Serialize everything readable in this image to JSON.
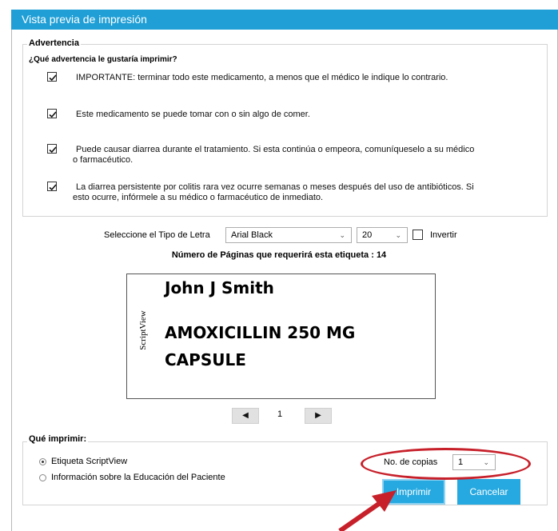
{
  "window": {
    "title": "Vista previa de impresión"
  },
  "warning": {
    "group_title": "Advertencia",
    "question": "¿Qué advertencia le gustaría imprimir?",
    "items": [
      {
        "checked": true,
        "line1": "IMPORTANTE: terminar todo este medicamento, a menos que el médico le indique lo contrario.",
        "line2": ""
      },
      {
        "checked": true,
        "line1": "Este medicamento se puede tomar con o sin algo de comer.",
        "line2": ""
      },
      {
        "checked": true,
        "line1": "Puede causar diarrea durante el tratamiento. Si esta continúa o empeora, comuníqueselo a su médico",
        "line2": "o farmacéutico."
      },
      {
        "checked": true,
        "line1": "La diarrea persistente por colitis rara vez ocurre semanas o meses después del uso de antibióticos. Si",
        "line2": "esto ocurre, infórmele a su médico o farmacéutico de inmediato."
      }
    ]
  },
  "font": {
    "label": "Seleccione el Tipo de Letra",
    "family": "Arial Black",
    "size": "20",
    "invert_label": "Invertir",
    "invert_checked": false
  },
  "pages": {
    "text": "Número de Páginas que requerirá esta etiqueta : 14"
  },
  "preview": {
    "brand": "ScriptView",
    "line1": "John J Smith",
    "line2": "AMOXICILLIN 250 MG",
    "line3": "CAPSULE"
  },
  "pager": {
    "prev_symbol": "◀",
    "current": "1",
    "next_symbol": "▶"
  },
  "print_what": {
    "group_title": "Qué imprimir:",
    "options": [
      {
        "label": "Etiqueta ScriptView",
        "selected": true
      },
      {
        "label": "Información sobre la Educación del Paciente",
        "selected": false
      }
    ],
    "copies_label": "No. de copias",
    "copies_value": "1"
  },
  "buttons": {
    "print": "Imprimir",
    "cancel": "Cancelar"
  },
  "colors": {
    "accent": "#26a9e0",
    "titlebar": "#1f9fd6",
    "annotation": "#c7202a"
  },
  "icons": {
    "check": "checkmark-icon",
    "dropdown": "chevron-down-icon",
    "prev": "triangle-left-icon",
    "next": "triangle-right-icon"
  }
}
